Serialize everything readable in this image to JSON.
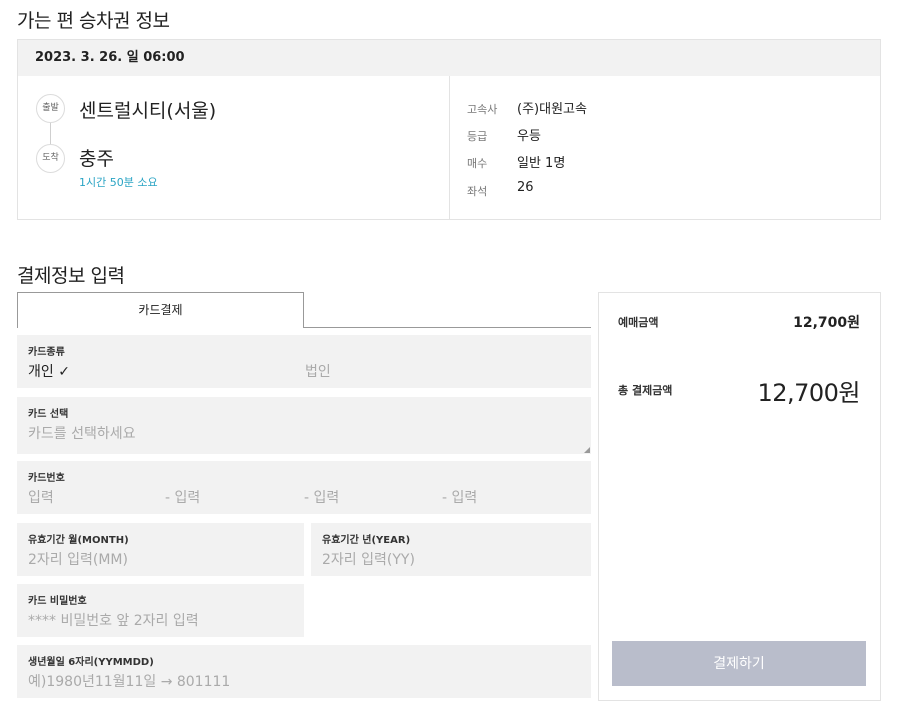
{
  "section1": {
    "title": "가는 편 승차권 정보"
  },
  "ticket": {
    "datetime": "2023. 3. 26. 일 06:00",
    "departure": {
      "badge": "출발",
      "place": "센트럴시티(서울)"
    },
    "arrival": {
      "badge": "도착",
      "place": "충주"
    },
    "duration": "1시간 50분 소요",
    "info": [
      {
        "key": "고속사",
        "value": "(주)대원고속"
      },
      {
        "key": "등급",
        "value": "우등"
      },
      {
        "key": "매수",
        "value": "일반 1명"
      },
      {
        "key": "좌석",
        "value": "26"
      }
    ]
  },
  "section2": {
    "title": "결제정보 입력"
  },
  "payment": {
    "tab_label": "카드결제",
    "card_type": {
      "label": "카드종류",
      "option_personal": "개인 ✓",
      "option_corporate": "법인"
    },
    "card_select": {
      "label": "카드 선택",
      "placeholder": "카드를 선택하세요"
    },
    "card_number": {
      "label": "카드번호",
      "p1": "입력",
      "p2": "- 입력",
      "p3": "- 입력",
      "p4": "- 입력"
    },
    "expiry_month": {
      "label": "유효기간 월(MONTH)",
      "placeholder": "2자리 입력(MM)"
    },
    "expiry_year": {
      "label": "유효기간 년(YEAR)",
      "placeholder": "2자리 입력(YY)"
    },
    "card_password": {
      "label": "카드 비밀번호",
      "placeholder": "**** 비밀번호 앞 2자리 입력"
    },
    "birth": {
      "label": "생년월일 6자리(YYMMDD)",
      "placeholder": "예)1980년11월11일 → 801111"
    }
  },
  "summary": {
    "sale_label": "예매금액",
    "sale_value": "12,700원",
    "total_label": "총 결제금액",
    "total_value": "12,700원",
    "pay_button": "결제하기"
  }
}
